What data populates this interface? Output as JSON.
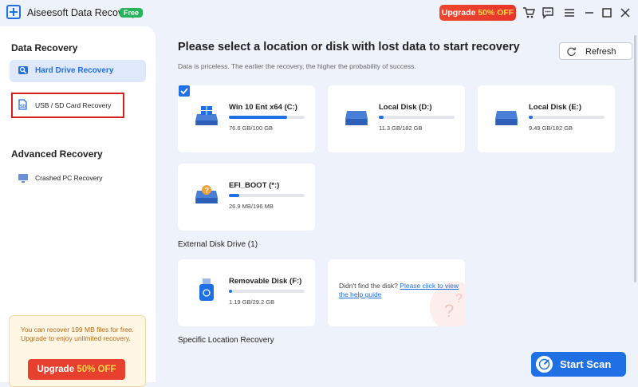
{
  "app": {
    "title": "Aiseesoft Data Recovery",
    "badge": "Free"
  },
  "topbar": {
    "upgrade_label": "Upgrade",
    "upgrade_pct": "50% OFF"
  },
  "sidebar": {
    "section1": "Data Recovery",
    "items": [
      {
        "label": "Hard Drive Recovery"
      },
      {
        "label": "USB / SD Card Recovery"
      }
    ],
    "section2": "Advanced Recovery",
    "advanced_items": [
      {
        "label": "Crashed PC Recovery"
      }
    ],
    "promo_text": "You can recover 199 MB files for free. Upgrade to enjoy unlimited recovery.",
    "promo_button_label": "Upgrade",
    "promo_button_pct": "50% OFF"
  },
  "main": {
    "heading": "Please select a location or disk with lost data to start recovery",
    "subheading": "Data is priceless. The earlier the recovery, the higher the probability of success.",
    "refresh_label": "Refresh",
    "disks": [
      {
        "name": "Win 10 Ent x64 (C:)",
        "size": "76.6 GB/100 GB",
        "used_fraction": 0.766,
        "selected": true
      },
      {
        "name": "Local Disk (D:)",
        "size": "11.3 GB/182 GB",
        "used_fraction": 0.062
      },
      {
        "name": "Local Disk (E:)",
        "size": "9.49 GB/182 GB",
        "used_fraction": 0.052
      },
      {
        "name": "EFI_BOOT (*:)",
        "size": "26.9 MB/196 MB",
        "used_fraction": 0.137
      }
    ],
    "external_label": "External Disk Drive (1)",
    "external": [
      {
        "name": "Removable Disk (F:)",
        "size": "1.19 GB/29.2 GB",
        "used_fraction": 0.041
      }
    ],
    "help_text": "Didn't find the disk?",
    "help_link": "Please click to view the help guide",
    "specific_label": "Specific Location Recovery",
    "start_scan_label": "Start Scan"
  },
  "colors": {
    "accent": "#1f6fe5",
    "upgrade": "#e8402f",
    "free_badge": "#25b45a"
  }
}
